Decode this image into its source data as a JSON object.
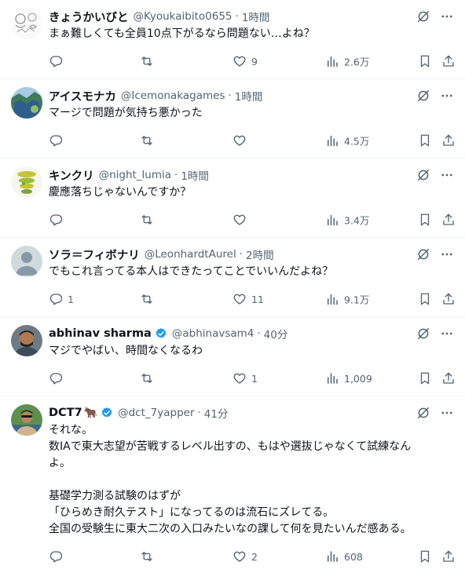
{
  "posts": [
    {
      "name": "きょうかいびと",
      "handle": "@Kyoukaibito0655",
      "time": "1時間",
      "verified": false,
      "lines": [
        "まぁ難しくても全員10点下がるなら問題ない…よね？"
      ],
      "replies": "",
      "reposts": "",
      "likes": "9",
      "views": "2.6万"
    },
    {
      "name": "アイスモナカ",
      "handle": "@Icemonakagames",
      "time": "1時間",
      "verified": false,
      "lines": [
        "マージで問題が気持ち悪かった"
      ],
      "replies": "",
      "reposts": "",
      "likes": "",
      "views": "4.5万"
    },
    {
      "name": "キンクリ",
      "handle": "@night_lumia",
      "time": "1時間",
      "verified": false,
      "lines": [
        "慶應落ちじゃないんですか？"
      ],
      "replies": "",
      "reposts": "",
      "likes": "",
      "views": "3.4万"
    },
    {
      "name": "ソラ＝フィボナリ",
      "handle": "@LeonhardtAurel",
      "time": "2時間",
      "verified": false,
      "lines": [
        "でもこれ言ってる本人はできたってことでいいんだよね？"
      ],
      "replies": "1",
      "reposts": "",
      "likes": "11",
      "views": "9.1万"
    },
    {
      "name": "abhinav sharma",
      "handle": "@abhinavsam4",
      "time": "40分",
      "verified": true,
      "lines": [
        "マジでやばい、時間なくなるわ"
      ],
      "replies": "",
      "reposts": "",
      "likes": "1",
      "views": "1,009"
    },
    {
      "name": "DCT7",
      "name_emoji": "🐂",
      "handle": "@dct_7yapper",
      "time": "41分",
      "verified": true,
      "lines": [
        "それな。",
        "数IAで東大志望が苦戦するレベル出すの、もはや選抜じゃなくて試練なん",
        "よ。",
        "",
        "基礎学力測る試験のはずが",
        "「ひらめき耐久テスト」になってるのは流石にズレてる。",
        "全国の受験生に東大二次の入口みたいなの課して何を見たいんだ感ある。"
      ],
      "replies": "",
      "reposts": "",
      "likes": "2",
      "views": "608"
    }
  ],
  "dot": "·",
  "icons": {
    "reply": "reply-icon",
    "repost": "repost-icon",
    "like": "heart-icon",
    "views": "views-icon",
    "bookmark": "bookmark-icon",
    "share": "share-icon",
    "grok": "grok-icon",
    "more": "more-icon"
  },
  "colors": {
    "text": "#0f1419",
    "secondary": "#536471",
    "verified": "#1d9bf0",
    "divider": "#eff3f4"
  }
}
